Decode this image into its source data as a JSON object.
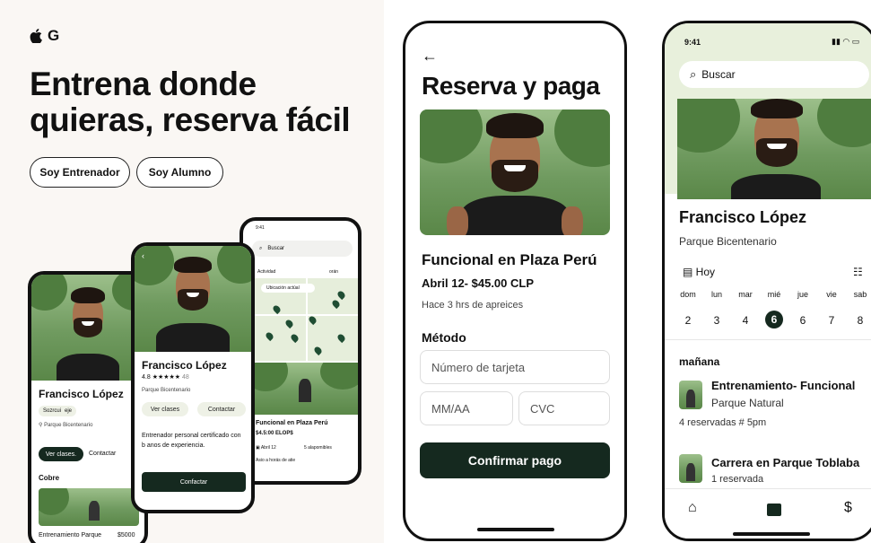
{
  "left": {
    "logo": {
      "apple": "",
      "letter": "G"
    },
    "hero_line1": "Entrena donde",
    "hero_line2": "quieras, reserva fácil",
    "buttons": [
      "Soy Entrenador",
      "Soy Alumno"
    ]
  },
  "phone_a": {
    "name": "Francisco López",
    "tag1": "Sozrcui",
    "tag2": "eje",
    "location": "Parque Bicentenario",
    "btn_primary": "Ver clases.",
    "btn_secondary": "Contactar",
    "section": "Cobre",
    "footer_title": "Entrenamiento Parque",
    "footer_price": "$5000"
  },
  "phone_b": {
    "name": "Francisco López",
    "rating": "4.8",
    "stars": "★★★★★",
    "reviews": "48",
    "location": "Parque Bicentenario",
    "btn1": "Ver clases",
    "btn2": "Contactar",
    "bio": "Entrenador personal certificado con b anos de experiencia.",
    "cta": "Confactar"
  },
  "phone_c": {
    "time": "9:41",
    "search": "Buscar",
    "filter_left": "Actividad",
    "filter_right": "orán",
    "location_chip": "Ubicación actúal",
    "card_title": "Funcional en Plaza Perú",
    "card_price": "$4.5:00 ELOP$",
    "card_date": "Abril 12",
    "card_spots": "5 alapomibles",
    "card_note": "Asio a horás de atie"
  },
  "checkout": {
    "back_icon": "←",
    "title": "Reserva y paga",
    "class_title": "Funcional en Plaza Perú",
    "date_price": "Abril 12- $45.00 CLP",
    "posted": "Hace 3 hrs de apreices",
    "method_label": "Método",
    "card_placeholder": "Número de tarjeta",
    "expiry_placeholder": "MM/AA",
    "cvc_placeholder": "CVC",
    "confirm": "Confirmar pago"
  },
  "profile": {
    "time": "9:41",
    "search": "Buscar",
    "name": "Francisco López",
    "location": "Parque Bicentenario",
    "today": "Hoy",
    "days": [
      "dom",
      "lun",
      "mar",
      "mié",
      "jue",
      "vie",
      "sab"
    ],
    "dates": [
      "2",
      "3",
      "4",
      "6",
      "6",
      "7",
      "8"
    ],
    "selected_index": 3,
    "section": "mañana",
    "items": [
      {
        "title": "Entrenamiento- Funcional",
        "subtitle": "Parque Natural",
        "meta": "4 reservadas  # 5pm"
      },
      {
        "title": "Carrera en Parque Toblaba",
        "subtitle": "1 reservada",
        "meta": ""
      }
    ],
    "nav_dollar": "$"
  },
  "colors": {
    "accent": "#15291f",
    "mint": "#e8f0dc",
    "page": "#faf7f4"
  }
}
